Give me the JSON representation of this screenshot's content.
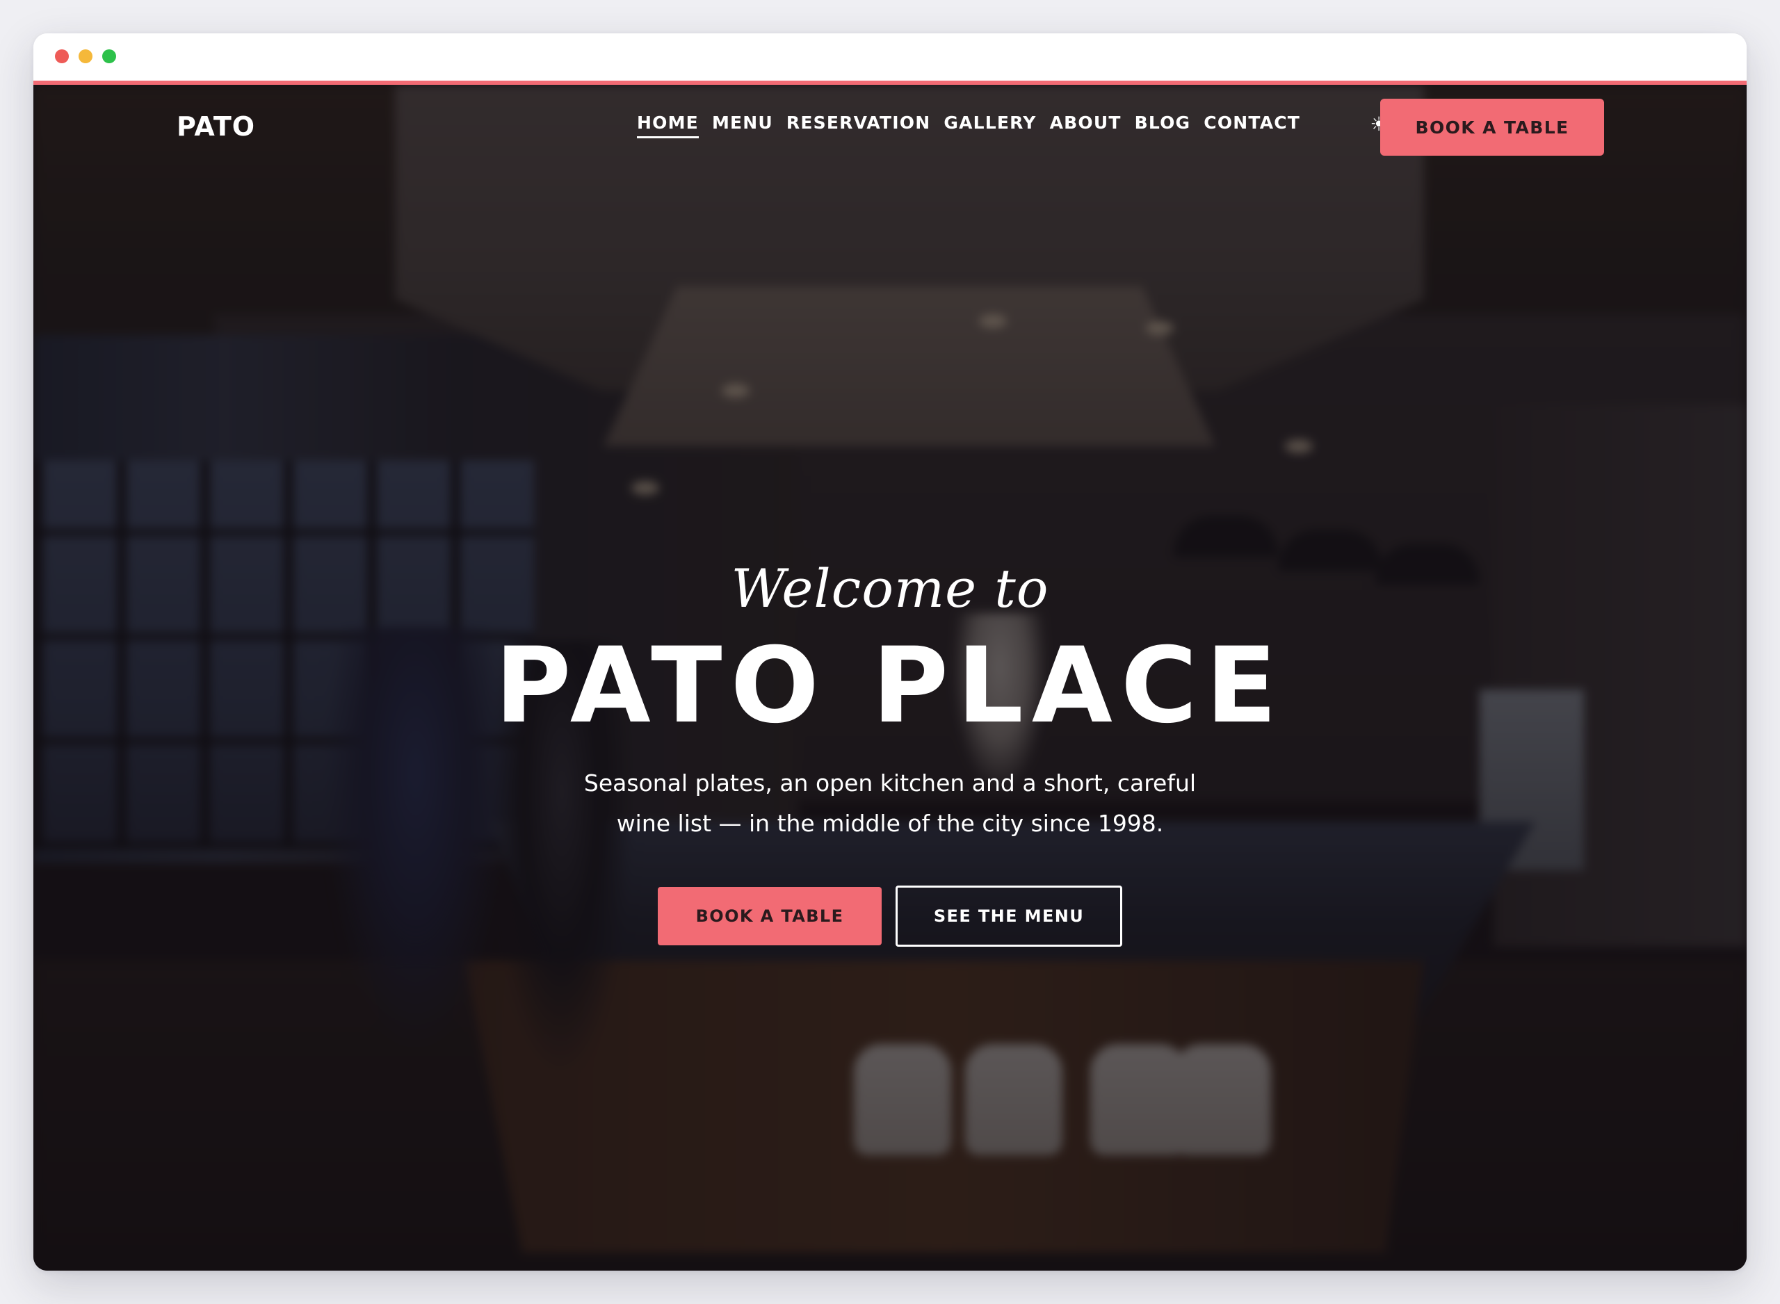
{
  "brand": {
    "logo_text": "PATO",
    "accent_color": "#f26b74"
  },
  "nav": {
    "items": [
      {
        "label": "HOME",
        "active": true
      },
      {
        "label": "MENU",
        "active": false
      },
      {
        "label": "RESERVATION",
        "active": false
      },
      {
        "label": "GALLERY",
        "active": false
      },
      {
        "label": "ABOUT",
        "active": false
      },
      {
        "label": "BLOG",
        "active": false
      },
      {
        "label": "CONTACT",
        "active": false
      }
    ],
    "theme_toggle_icon": "☀",
    "cta_label": "BOOK A TABLE"
  },
  "hero": {
    "eyebrow": "Welcome to",
    "title": "PATO PLACE",
    "subtitle_line1": "Seasonal plates, an open kitchen and a short, careful",
    "subtitle_line2": "wine list — in the middle of the city since 1998.",
    "primary_button": "BOOK A TABLE",
    "secondary_button": "SEE THE MENU"
  },
  "window": {
    "controls": [
      "close",
      "minimize",
      "maximize"
    ]
  }
}
